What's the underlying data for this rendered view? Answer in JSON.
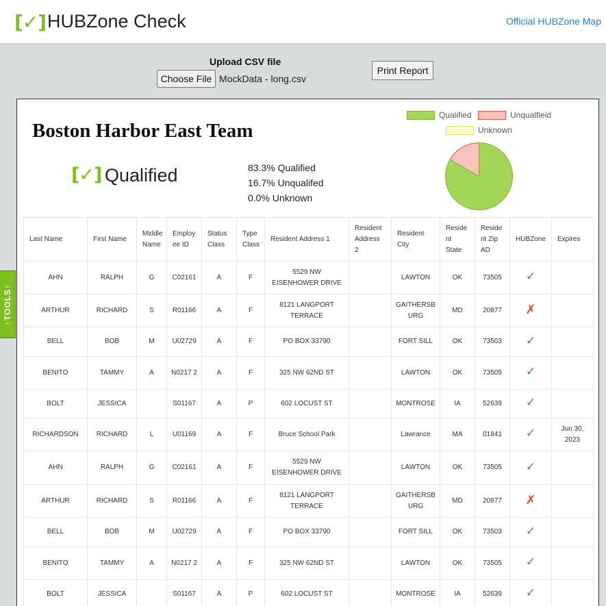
{
  "header": {
    "logo_mark": "[✓]",
    "title": "HUBZone Check",
    "map_link": "Official HUBZone Map"
  },
  "upload": {
    "label": "Upload CSV file",
    "choose_button": "Choose File",
    "file_name": "MockData - long.csv",
    "print_button": "Print Report"
  },
  "tools_tab": "↑TOOLS↑",
  "report": {
    "title": "Boston Harbor East Team",
    "status_mark": "[✓]",
    "status_label": "Qualified",
    "stats": [
      "83.3% Qualified",
      "16.7% Unqualifed",
      "0.0% Unknown"
    ],
    "legend": [
      {
        "label": "Qualified",
        "color": "#a3d556",
        "border": "#7cb33a"
      },
      {
        "label": "Unqualfieid",
        "color": "#f8c3bc",
        "border": "#e05a48"
      },
      {
        "label": "Unknown",
        "color": "#fdf9c8",
        "border": "#e8de6a"
      }
    ]
  },
  "chart_data": {
    "type": "pie",
    "categories": [
      "Qualified",
      "Unqualfieid",
      "Unknown"
    ],
    "values": [
      83.3,
      16.7,
      0.0
    ],
    "colors": [
      "#a3d556",
      "#f8c3bc",
      "#fdf9c8"
    ]
  },
  "table": {
    "columns": [
      "Last Name",
      "First Name",
      "Middle Name",
      "Employ ee ID",
      "Status Class",
      "Type Class",
      "Resident Address 1",
      "Resident Address 2",
      "Resident City",
      "Reside nt State",
      "Reside nt Zip AD",
      "HUBZone",
      "Expires"
    ],
    "rows": [
      [
        "AHN",
        "RALPH",
        "G",
        "C02161",
        "A",
        "F",
        "5529 NW EISENHOWER DRIVE",
        "",
        "LAWTON",
        "OK",
        "73505",
        "yes",
        ""
      ],
      [
        "ARTHUR",
        "RICHARD",
        "S",
        "R01166",
        "A",
        "F",
        "8121 LANGPORT TERRACE",
        "",
        "GAITHERSB URG",
        "MD",
        "20877",
        "no",
        ""
      ],
      [
        "BELL",
        "BOB",
        "M",
        "U02729",
        "A",
        "F",
        "PO BOX 33790",
        "",
        "FORT SILL",
        "OK",
        "73503",
        "yes",
        ""
      ],
      [
        "BENITO",
        "TAMMY",
        "A",
        "N0217 2",
        "A",
        "F",
        "325 NW 62ND ST",
        "",
        "LAWTON",
        "OK",
        "73505",
        "yes",
        ""
      ],
      [
        "BOLT",
        "JESSICA",
        "",
        "S01167",
        "A",
        "P",
        "602 LOCUST ST",
        "",
        "MONTROSE",
        "IA",
        "52639",
        "yes",
        ""
      ],
      [
        "RICHARDSON",
        "RICHARD",
        "L",
        "U01169",
        "A",
        "F",
        "Bruce School Park",
        "",
        "Lawrance",
        "MA",
        "01841",
        "yes",
        "Jun 30, 2023"
      ],
      [
        "AHN",
        "RALPH",
        "G",
        "C02161",
        "A",
        "F",
        "5529 NW EISENHOWER DRIVE",
        "",
        "LAWTON",
        "OK",
        "73505",
        "yes",
        ""
      ],
      [
        "ARTHUR",
        "RICHARD",
        "S",
        "R01166",
        "A",
        "F",
        "8121 LANGPORT TERRACE",
        "",
        "GAITHERSB URG",
        "MD",
        "20877",
        "no",
        ""
      ],
      [
        "BELL",
        "BOB",
        "M",
        "U02729",
        "A",
        "F",
        "PO BOX 33790",
        "",
        "FORT SILL",
        "OK",
        "73503",
        "yes",
        ""
      ],
      [
        "BENITO",
        "TAMMY",
        "A",
        "N0217 2",
        "A",
        "F",
        "325 NW 62ND ST",
        "",
        "LAWTON",
        "OK",
        "73505",
        "yes",
        ""
      ],
      [
        "BOLT",
        "JESSICA",
        "",
        "S01167",
        "A",
        "P",
        "602 LOCUST ST",
        "",
        "MONTROSE",
        "IA",
        "52639",
        "yes",
        ""
      ]
    ]
  },
  "icons": {
    "qualified": "check-icon",
    "unqualified": "x-icon"
  }
}
